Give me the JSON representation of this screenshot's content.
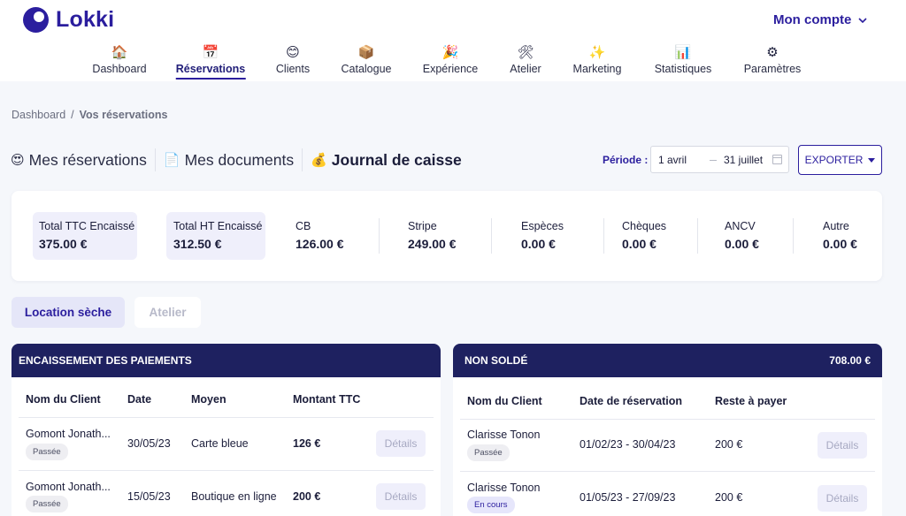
{
  "brand": {
    "name": "Lokki"
  },
  "account": {
    "label": "Mon compte"
  },
  "nav": [
    {
      "label": "Dashboard",
      "icon": "🏠"
    },
    {
      "label": "Réservations",
      "icon": "📅"
    },
    {
      "label": "Clients",
      "icon": "😊"
    },
    {
      "label": "Catalogue",
      "icon": "📦"
    },
    {
      "label": "Expérience",
      "icon": "🎉"
    },
    {
      "label": "Atelier",
      "icon": "🛠"
    },
    {
      "label": "Marketing",
      "icon": "✨"
    },
    {
      "label": "Statistiques",
      "icon": "📊"
    },
    {
      "label": "Paramètres",
      "icon": "⚙"
    }
  ],
  "breadcrumb": {
    "root": "Dashboard",
    "sep": "/",
    "current": "Vos réservations"
  },
  "doc_tabs": [
    {
      "label": "Mes réservations",
      "icon": "😍"
    },
    {
      "label": "Mes documents",
      "icon": "📄"
    },
    {
      "label": "Journal de caisse",
      "icon": "💰"
    }
  ],
  "period": {
    "label": "Période :",
    "start": "1 avril",
    "end": "31 juillet"
  },
  "export": {
    "label": "EXPORTER"
  },
  "totals": [
    {
      "label": "Total TTC Encaissé",
      "value": "375.00 €"
    },
    {
      "label": "Total HT Encaissé",
      "value": "312.50 €"
    },
    {
      "label": "CB",
      "value": "126.00 €"
    },
    {
      "label": "Stripe",
      "value": "249.00 €"
    },
    {
      "label": "Espèces",
      "value": "0.00 €"
    },
    {
      "label": "Chèques",
      "value": "0.00 €"
    },
    {
      "label": "ANCV",
      "value": "0.00 €"
    },
    {
      "label": "Autre",
      "value": "0.00 €"
    }
  ],
  "subtabs": {
    "active": "Location sèche",
    "inactive": "Atelier"
  },
  "payments": {
    "title": "ENCAISSEMENT DES PAIEMENTS",
    "columns": [
      "Nom du Client",
      "Date",
      "Moyen",
      "Montant TTC"
    ],
    "rows": [
      {
        "client": "Gomont Jonath...",
        "status": "Passée",
        "date": "30/05/23",
        "method": "Carte bleue",
        "amount": "126 €",
        "action": "Détails"
      },
      {
        "client": "Gomont Jonath...",
        "status": "Passée",
        "date": "15/05/23",
        "method": "Boutique en ligne",
        "amount": "200 €",
        "action": "Détails"
      }
    ]
  },
  "unpaid": {
    "title": "NON SOLDÉ",
    "total": "708.00 €",
    "columns": [
      "Nom du Client",
      "Date de réservation",
      "Reste à payer"
    ],
    "rows": [
      {
        "client": "Clarisse Tonon",
        "status": "Passée",
        "dates": "01/02/23 - 30/04/23",
        "remaining": "200 €",
        "action": "Détails"
      },
      {
        "client": "Clarisse Tonon",
        "status": "En cours",
        "dates": "01/05/23 - 27/09/23",
        "remaining": "200 €",
        "action": "Détails"
      }
    ]
  }
}
